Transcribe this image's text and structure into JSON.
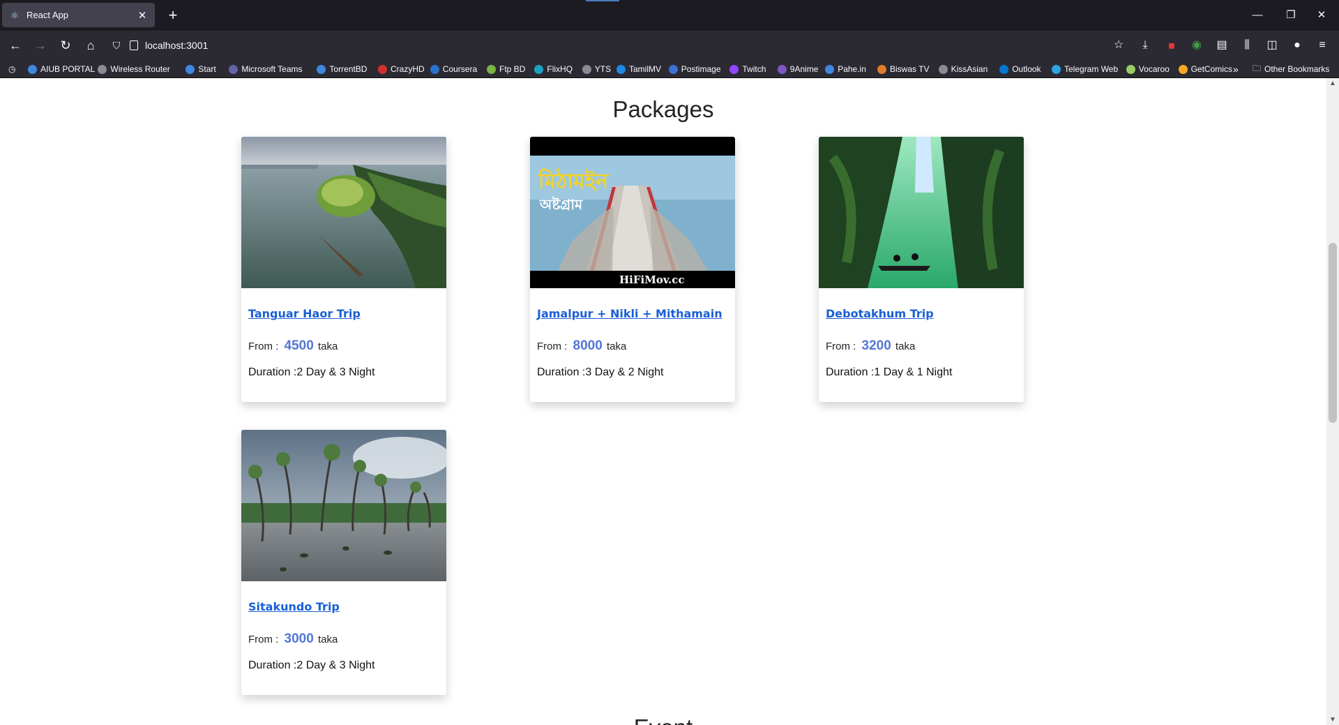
{
  "browser": {
    "tab": {
      "title": "React App"
    },
    "url": "localhost:3001",
    "bookmarks": [
      {
        "label": "AIUB PORTAL",
        "color": "#3d87e0"
      },
      {
        "label": "Wireless Router",
        "color": "#8a8a94"
      },
      {
        "label": "Start",
        "color": "#3d87e0"
      },
      {
        "label": "Microsoft Teams",
        "color": "#6264a7"
      },
      {
        "label": "TorrentBD",
        "color": "#3d87e0"
      },
      {
        "label": "CrazyHD",
        "color": "#d32f2f"
      },
      {
        "label": "Coursera",
        "color": "#2a73cc"
      },
      {
        "label": "Ftp BD",
        "color": "#7cb342"
      },
      {
        "label": "FlixHQ",
        "color": "#1aa3c4"
      },
      {
        "label": "YTS",
        "color": "#8a8a94"
      },
      {
        "label": "TamilMV",
        "color": "#1e88e5"
      },
      {
        "label": "Postimage",
        "color": "#3d6fd6"
      },
      {
        "label": "Twitch",
        "color": "#9146ff"
      },
      {
        "label": "9Anime",
        "color": "#7e57c2"
      },
      {
        "label": "Pahe.in",
        "color": "#3d87e0"
      },
      {
        "label": "Biswas TV",
        "color": "#e07b2a"
      },
      {
        "label": "KissAsian",
        "color": "#8a8a94"
      },
      {
        "label": "Outlook",
        "color": "#0078d4"
      },
      {
        "label": "Telegram Web",
        "color": "#2ca5e0"
      },
      {
        "label": "Vocaroo",
        "color": "#9ccc65"
      },
      {
        "label": "GetComics",
        "color": "#f9a825"
      }
    ],
    "other_bookmarks": "Other Bookmarks"
  },
  "page": {
    "section_title": "Packages",
    "next_section_title": "Event",
    "price_prefix": "From :",
    "currency": "taka",
    "duration_prefix": "Duration :",
    "packages": [
      {
        "name": "Tanguar Haor Trip",
        "price": "4500",
        "duration": "2 Day & 3 Night",
        "image": "haor-lake"
      },
      {
        "name": "Jamalpur + Nikli + Mithamain",
        "price": "8000",
        "duration": "3 Day & 2 Night",
        "image": "mithamain-road",
        "image_overlay": "HiFiMov.cc"
      },
      {
        "name": "Debotakhum Trip",
        "price": "3200",
        "duration": "1 Day & 1 Night",
        "image": "green-canyon"
      },
      {
        "name": "Sitakundo Trip",
        "price": "3000",
        "duration": "2 Day & 3 Night",
        "image": "mangrove-beach"
      }
    ]
  },
  "colors": {
    "link": "#1a5fd6",
    "price": "#5277d4",
    "chrome_dark": "#1c1b22",
    "chrome": "#2b2a33"
  }
}
